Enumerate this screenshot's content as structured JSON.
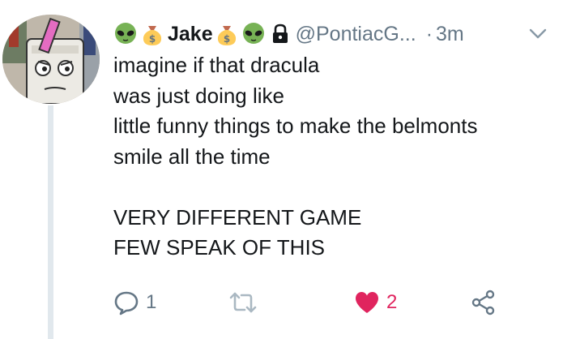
{
  "tweet": {
    "display_name": "Jake",
    "handle": "@PontiacG...",
    "separator": "·",
    "time": "3m",
    "name_emojis": [
      "alien-emoji",
      "money-bag-emoji",
      "money-bag-emoji",
      "alien-emoji"
    ],
    "protected": true,
    "text_lines": [
      "imagine if that dracula",
      "was just doing like",
      "little funny things to make the belmonts",
      "smile all the time",
      "",
      "VERY DIFFERENT GAME",
      "FEW SPEAK OF THIS"
    ],
    "actions": {
      "reply_count": "1",
      "retweet_count": "",
      "like_count": "2",
      "liked": true
    }
  },
  "colors": {
    "text": "#14171a",
    "secondary": "#657786",
    "like": "#e0245e",
    "thread_line": "#e1e8ed",
    "alien": "#77b255",
    "money_bag": "#fdcb58"
  }
}
